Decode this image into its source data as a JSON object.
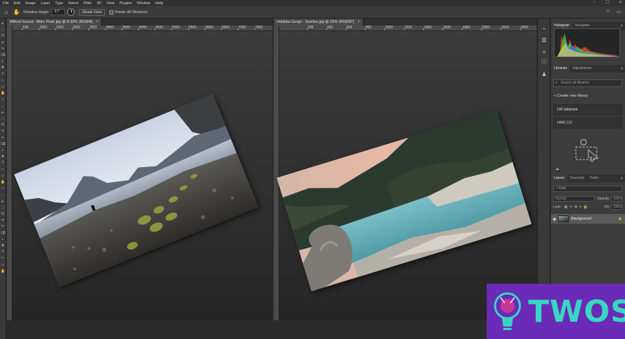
{
  "menubar": {
    "items": [
      "File",
      "Edit",
      "Image",
      "Layer",
      "Type",
      "Select",
      "Filter",
      "3D",
      "View",
      "Plugins",
      "Window",
      "Help"
    ]
  },
  "options_bar": {
    "rotation_label": "Rotation Angle:",
    "rotation_value": "-17°",
    "reset_view": "Reset View",
    "rotate_all": "Rotate All Windows"
  },
  "docA": {
    "tab_title": "Milford Sound - Mitre Peak.jpg @ 8.33% (RGB/8)",
    "ruler_ticks": [
      "500",
      "1000",
      "1500",
      "2000",
      "2500",
      "3000",
      "3500",
      "4000",
      "4500",
      "5000",
      "5500",
      "6000",
      "6500",
      "7000",
      "7500"
    ]
  },
  "docB": {
    "tab_title": "Hokitika Gorge - Sunrise.jpg @ 25% (RGB/8*)",
    "ruler_ticks": [
      "200",
      "400",
      "600",
      "800",
      "1000",
      "1200",
      "1400",
      "1600",
      "1800",
      "2000",
      "2200",
      "2400"
    ]
  },
  "panels": {
    "histogram_tabs": [
      "Histogram",
      "Navigator"
    ],
    "libraries_tabs": [
      "Libraries",
      "Adjustments"
    ],
    "library_search_placeholder": "Search all libraries",
    "create_library": "Create new library",
    "libraries": [
      "DR bibliotek",
      "HMC CC"
    ],
    "layers_tabs": [
      "Layers",
      "Channels",
      "Paths"
    ],
    "layers_kind": "Kind",
    "blend_mode": "Normal",
    "opacity_label": "Opacity:",
    "opacity_value": "100%",
    "lock_label": "Lock:",
    "fill_label": "Fill:",
    "fill_value": "100%",
    "layer_name": "Background"
  },
  "watermark": {
    "text": "TWOS"
  }
}
